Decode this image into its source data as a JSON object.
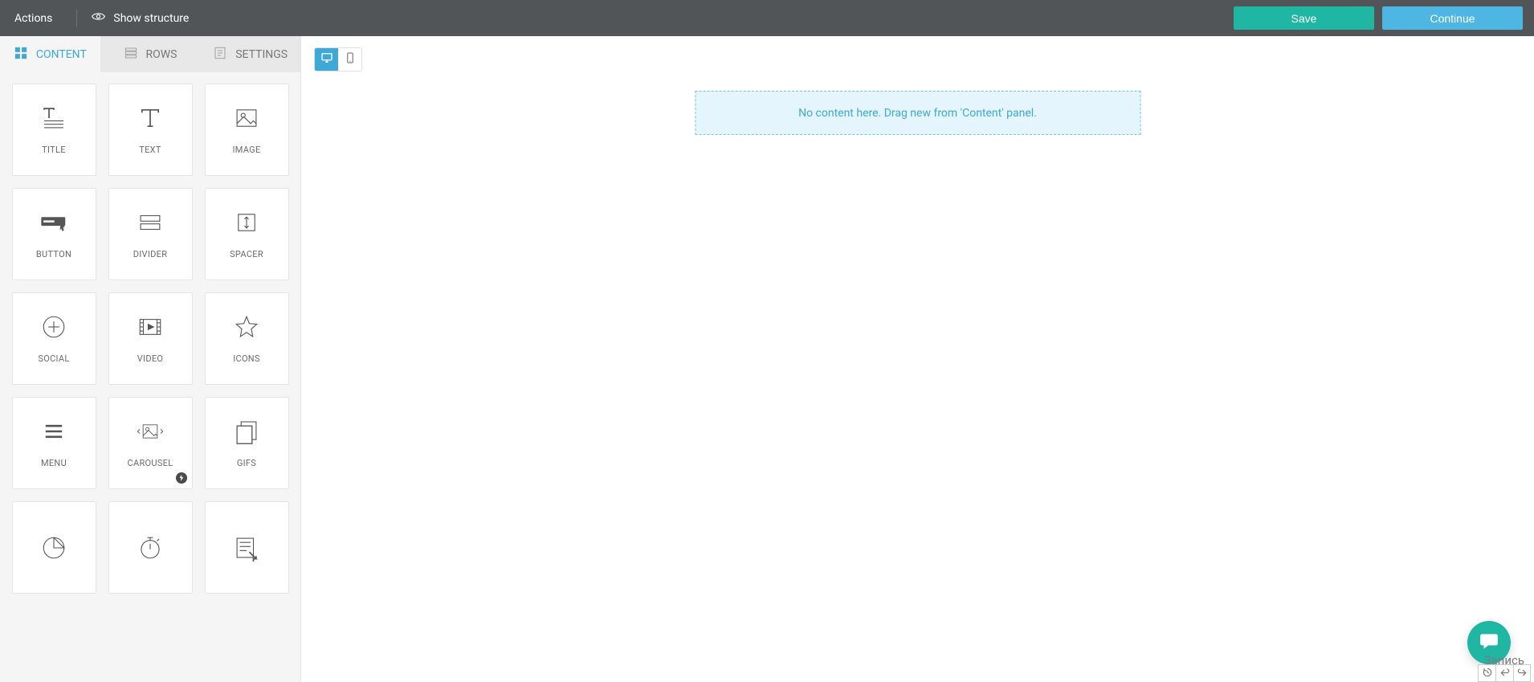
{
  "header": {
    "actions_label": "Actions",
    "show_structure_label": "Show structure",
    "save_label": "Save",
    "continue_label": "Continue"
  },
  "sidebar": {
    "tabs": {
      "content": "CONTENT",
      "rows": "ROWS",
      "settings": "SETTINGS"
    },
    "tiles": {
      "title": "TITLE",
      "text": "TEXT",
      "image": "IMAGE",
      "button": "BUTTON",
      "divider": "DIVIDER",
      "spacer": "SPACER",
      "social": "SOCIAL",
      "video": "VIDEO",
      "icons": "ICONS",
      "menu": "MENU",
      "carousel": "CAROUSEL",
      "gifs": "GIFS"
    }
  },
  "canvas": {
    "empty_message": "No content here. Drag new from 'Content' panel."
  },
  "footer": {
    "record_label": "Запись"
  }
}
